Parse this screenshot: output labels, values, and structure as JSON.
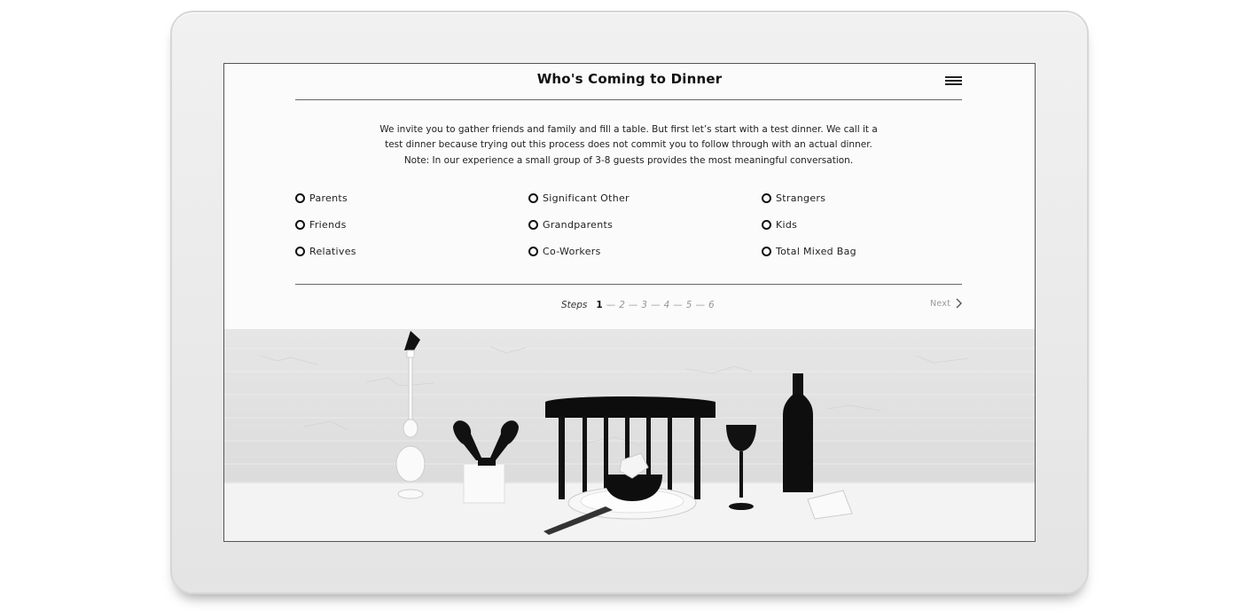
{
  "header": {
    "title": "Who's Coming to Dinner"
  },
  "intro": {
    "lines": [
      "We invite you to gather friends and family and fill a table. But first let’s start with a test dinner. We call it a",
      "test dinner because trying out this process does not commit you to follow through with an actual dinner.",
      "Note: In our experience a small group of 3-8 guests provides the most meaningful conversation."
    ]
  },
  "options": {
    "col1": [
      "Parents",
      "Friends",
      "Relatives"
    ],
    "col2": [
      "Significant Other",
      "Grandparents",
      "Co-Workers"
    ],
    "col3": [
      "Strangers",
      "Kids",
      "Total Mixed Bag"
    ]
  },
  "steps": {
    "label": "Steps",
    "current": "1",
    "items": [
      "2",
      "3",
      "4",
      "5",
      "6"
    ]
  },
  "nav": {
    "next_label": "Next"
  },
  "colors": {
    "frame": "#ececec",
    "text": "#111111",
    "muted": "#999999"
  }
}
